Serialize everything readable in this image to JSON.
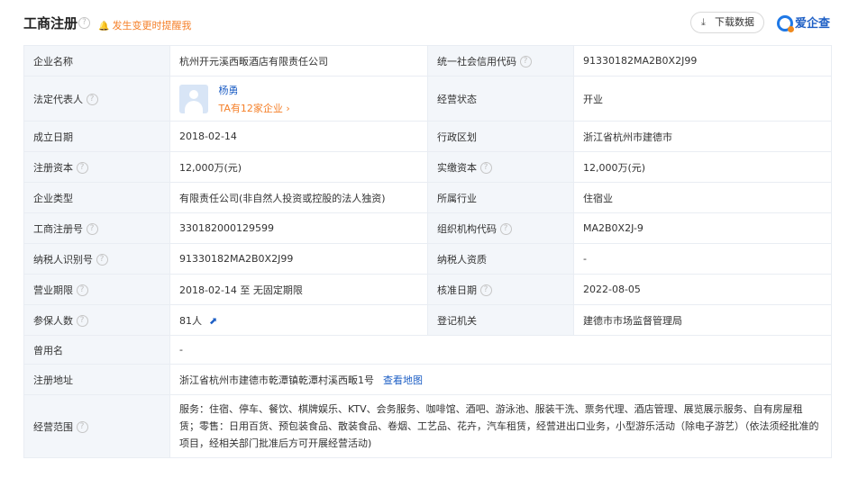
{
  "header": {
    "title": "工商注册",
    "alert_link": "发生变更时提醒我",
    "download_label": "下载数据",
    "brand_name": "爱企查"
  },
  "rows": [
    {
      "l1": "企业名称",
      "v1": "杭州开元溪西畈酒店有限责任公司",
      "l2": "统一社会信用代码",
      "v2": "91330182MA2B0X2J99"
    },
    {
      "l1": "法定代表人",
      "l2": "经营状态",
      "v2": "开业"
    },
    {
      "l1": "成立日期",
      "v1": "2018-02-14",
      "l2": "行政区划",
      "v2": "浙江省杭州市建德市"
    },
    {
      "l1": "注册资本",
      "v1": "12,000万(元)",
      "l2": "实缴资本",
      "v2": "12,000万(元)"
    },
    {
      "l1": "企业类型",
      "v1": "有限责任公司(非自然人投资或控股的法人独资)",
      "l2": "所属行业",
      "v2": "住宿业"
    },
    {
      "l1": "工商注册号",
      "v1": "330182000129599",
      "l2": "组织机构代码",
      "v2": "MA2B0X2J-9"
    },
    {
      "l1": "纳税人识别号",
      "v1": "91330182MA2B0X2J99",
      "l2": "纳税人资质",
      "v2": "-"
    },
    {
      "l1": "营业期限",
      "v1": "2018-02-14 至 无固定期限",
      "l2": "核准日期",
      "v2": "2022-08-05"
    },
    {
      "l1": "参保人数",
      "v1": "81人",
      "l2": "登记机关",
      "v2": "建德市市场监督管理局"
    },
    {
      "l1": "曾用名",
      "v1": "-"
    },
    {
      "l1": "注册地址",
      "v1": "浙江省杭州市建德市乾潭镇乾潭村溪西畈1号",
      "link": "查看地图"
    },
    {
      "l1": "经营范围",
      "v1": "服务：住宿、停车、餐饮、棋牌娱乐、KTV、会务服务、咖啡馆、酒吧、游泳池、服装干洗、票务代理、酒店管理、展览展示服务、自有房屋租赁；零售：日用百货、预包装食品、散装食品、卷烟、工艺品、花卉，汽车租赁，经营进出口业务，小型游乐活动（除电子游艺）（依法须经批准的项目，经相关部门批准后方可开展经营活动)"
    }
  ],
  "legal_rep": {
    "name": "杨勇",
    "related": "TA有12家企业",
    "related_arrow": "›"
  },
  "icons": {
    "help": "?",
    "bell": "🔔",
    "download": "⤓",
    "chart": "⬈"
  }
}
